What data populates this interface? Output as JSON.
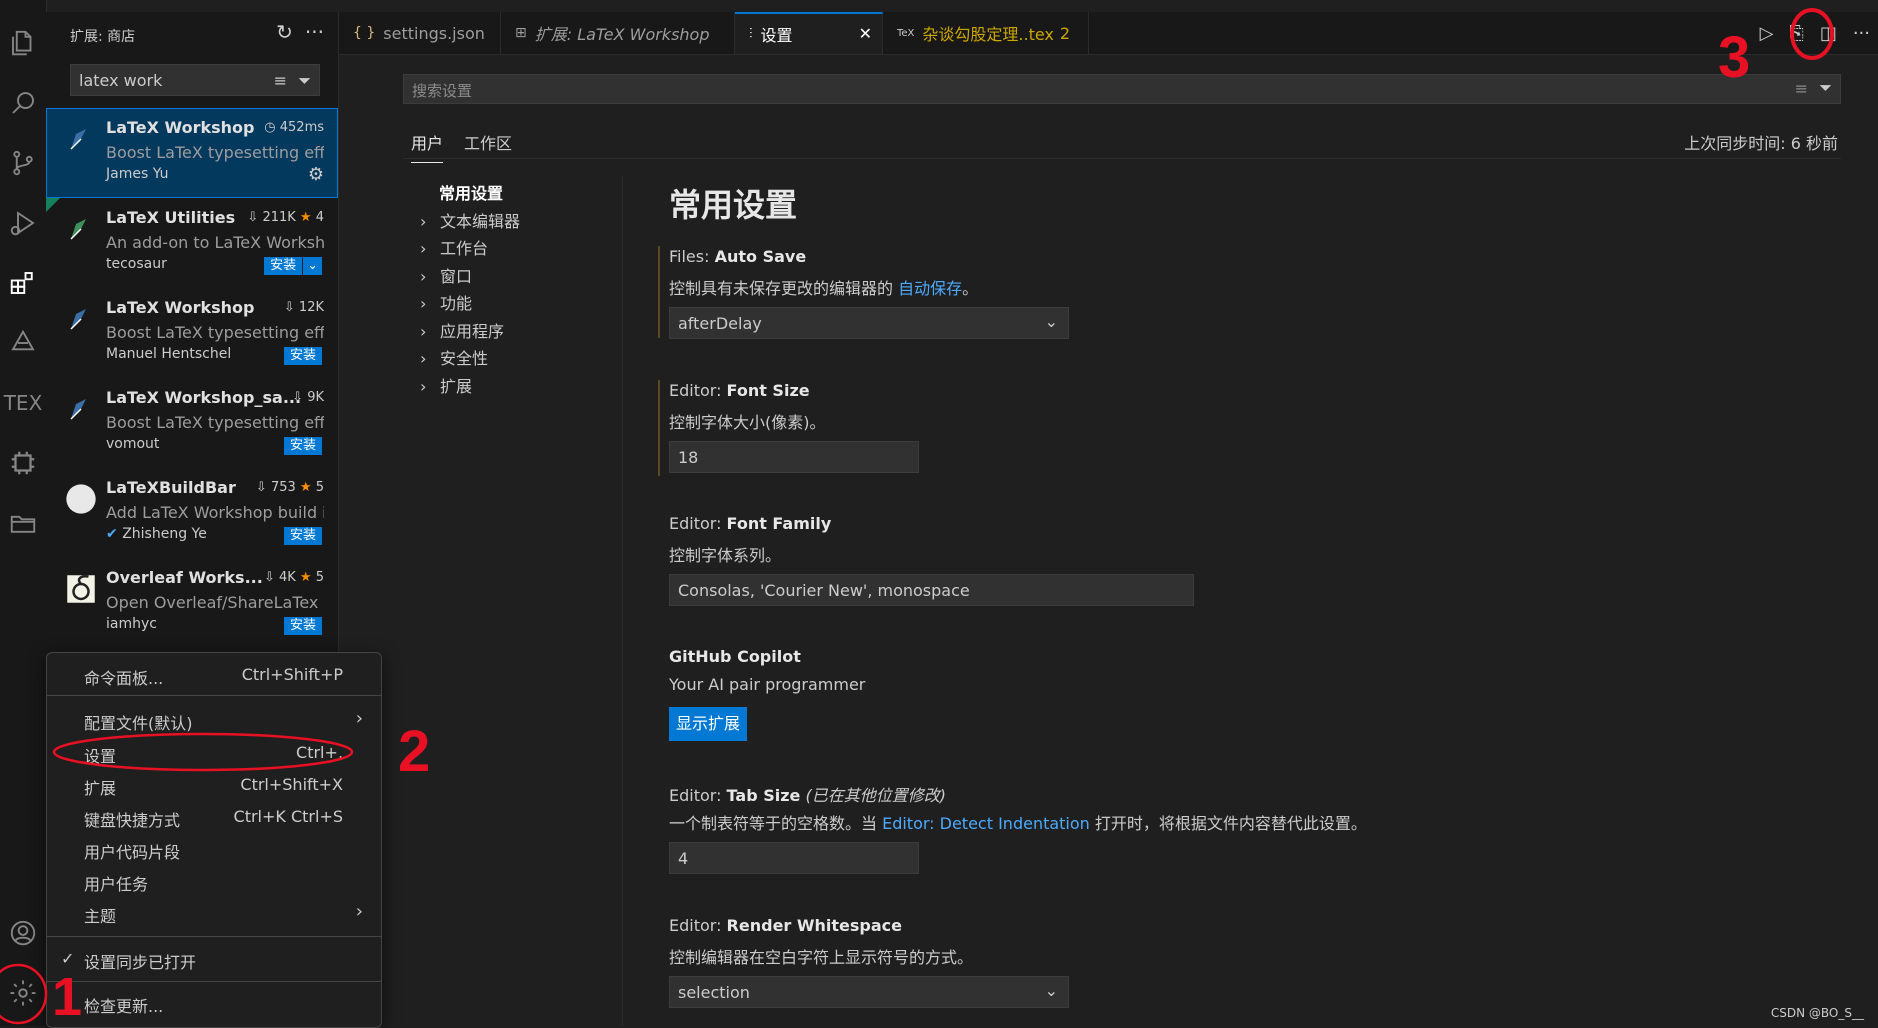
{
  "sidebar": {
    "title": "扩展: 商店",
    "search_value": "latex work",
    "extensions": [
      {
        "name": "LaTeX Workshop",
        "stat": "452ms",
        "stat_icon": "clock-icon",
        "description": "Boost LaTeX typesetting effi...",
        "author": "James Yu",
        "action": "gear"
      },
      {
        "name": "LaTeX Utilities",
        "stat": "211K",
        "rating": "4",
        "description": "An add-on to LaTeX Worksh...",
        "author": "tecosaur",
        "install_label": "安装"
      },
      {
        "name": "LaTeX Workshop",
        "stat": "12K",
        "description": "Boost LaTeX typesetting effi...",
        "author": "Manuel Hentschel",
        "install_label": "安装"
      },
      {
        "name": "LaTeX Workshop_sa...",
        "stat": "9K",
        "description": "Boost LaTeX typesetting effi...",
        "author": "vomout",
        "install_label": "安装"
      },
      {
        "name": "LaTeXBuildBar",
        "stat": "753",
        "rating": "5",
        "description": "Add LaTeX Workshop build i...",
        "author": "Zhisheng Ye",
        "install_label": "安装"
      },
      {
        "name": "Overleaf Works...",
        "stat": "4K",
        "rating": "5",
        "description": "Open Overleaf/ShareLaTex p...",
        "author": "iamhyc",
        "install_label": "安装"
      }
    ]
  },
  "tabs": [
    {
      "icon": "{ }",
      "label": "settings.json"
    },
    {
      "icon": "⊞",
      "label": "扩展: LaTeX Workshop"
    },
    {
      "icon": "⫶",
      "label": "设置",
      "close": "✕"
    },
    {
      "icon": "TeX",
      "label": "杂谈勾股定理..tex",
      "badge": "2"
    }
  ],
  "settings": {
    "search_placeholder": "搜索设置",
    "scope_tabs": [
      "用户",
      "工作区"
    ],
    "sync_status": "上次同步时间: 6 秒前",
    "toc": {
      "head": "常用设置",
      "items": [
        "文本编辑器",
        "工作台",
        "窗口",
        "功能",
        "应用程序",
        "安全性",
        "扩展"
      ]
    },
    "heading": "常用设置",
    "items": [
      {
        "category": "Files: ",
        "name": "Auto Save",
        "desc_pre": "控制具有未保存更改的编辑器的 ",
        "desc_link": "自动保存",
        "desc_post": "。",
        "value": "afterDelay"
      },
      {
        "category": "Editor: ",
        "name": "Font Size",
        "desc": "控制字体大小(像素)。",
        "value": "18"
      },
      {
        "category": "Editor: ",
        "name": "Font Family",
        "desc": "控制字体系列。",
        "value": "Consolas, 'Courier New', monospace"
      },
      {
        "name": "GitHub Copilot",
        "desc": "Your AI pair programmer",
        "button": "显示扩展"
      },
      {
        "category": "Editor: ",
        "name": "Tab Size",
        "modified": "(已在其他位置修改)",
        "desc_pre": "一个制表符等于的空格数。当 ",
        "desc_link": "Editor: Detect Indentation",
        "desc_post": " 打开时，将根据文件内容替代此设置。",
        "value": "4"
      },
      {
        "category": "Editor: ",
        "name": "Render Whitespace",
        "desc": "控制编辑器在空白字符上显示符号的方式。",
        "value": "selection"
      }
    ]
  },
  "menu": {
    "items": [
      {
        "label": "命令面板...",
        "key": "Ctrl+Shift+P"
      },
      {
        "label": "配置文件(默认)",
        "submenu": "›"
      },
      {
        "label": "设置",
        "key": "Ctrl+,"
      },
      {
        "label": "扩展",
        "key": "Ctrl+Shift+X"
      },
      {
        "label": "键盘快捷方式",
        "key": "Ctrl+K Ctrl+S"
      },
      {
        "label": "用户代码片段"
      },
      {
        "label": "用户任务"
      },
      {
        "label": "主题",
        "submenu": "›"
      },
      {
        "label": "设置同步已打开",
        "check": "✓"
      },
      {
        "label": "检查更新..."
      }
    ]
  },
  "annotations": {
    "n1": "1",
    "n2": "2",
    "n3": "3",
    "color": "#e81123"
  },
  "watermark": "CSDN @BO_S__",
  "colors": {
    "accent": "#0078d4",
    "link": "#4daafc",
    "star": "#ff8e00"
  }
}
